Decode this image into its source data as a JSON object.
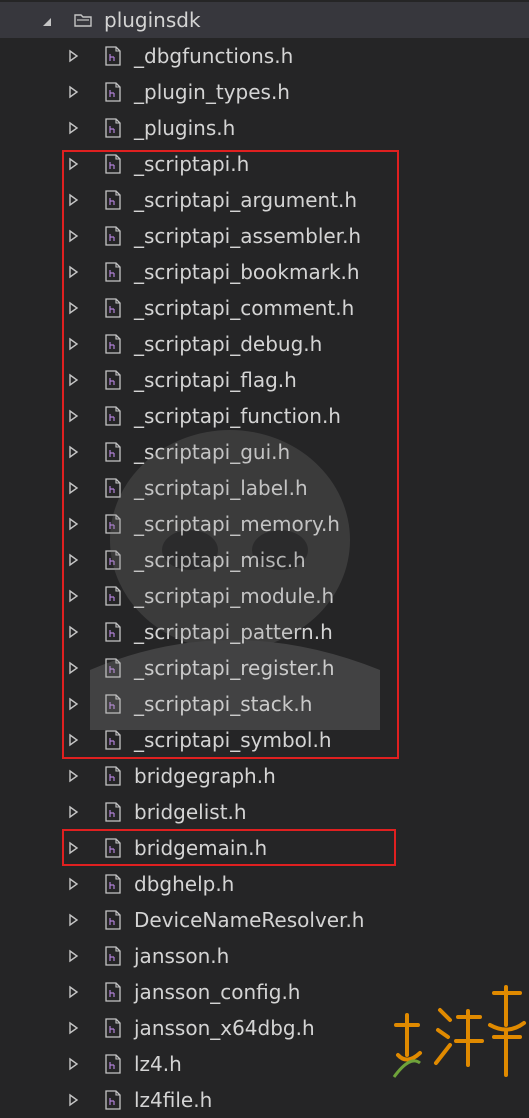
{
  "folder": {
    "name": "pluginsdk"
  },
  "files": [
    "_dbgfunctions.h",
    "_plugin_types.h",
    "_plugins.h",
    "_scriptapi.h",
    "_scriptapi_argument.h",
    "_scriptapi_assembler.h",
    "_scriptapi_bookmark.h",
    "_scriptapi_comment.h",
    "_scriptapi_debug.h",
    "_scriptapi_flag.h",
    "_scriptapi_function.h",
    "_scriptapi_gui.h",
    "_scriptapi_label.h",
    "_scriptapi_memory.h",
    "_scriptapi_misc.h",
    "_scriptapi_module.h",
    "_scriptapi_pattern.h",
    "_scriptapi_register.h",
    "_scriptapi_stack.h",
    "_scriptapi_symbol.h",
    "bridgegraph.h",
    "bridgelist.h",
    "bridgemain.h",
    "dbghelp.h",
    "DeviceNameResolver.h",
    "jansson.h",
    "jansson_config.h",
    "jansson_x64dbg.h",
    "lz4.h",
    "lz4file.h"
  ],
  "icons": {
    "expander": "triangle-right-icon",
    "folder_expander": "triangle-down-icon",
    "file": "header-file-icon",
    "folder": "folder-icon"
  },
  "colors": {
    "background": "#252526",
    "selected_row": "#37373d",
    "text": "#d4d4d4",
    "highlight_box": "#e02020",
    "watermark": "#e08a00"
  }
}
